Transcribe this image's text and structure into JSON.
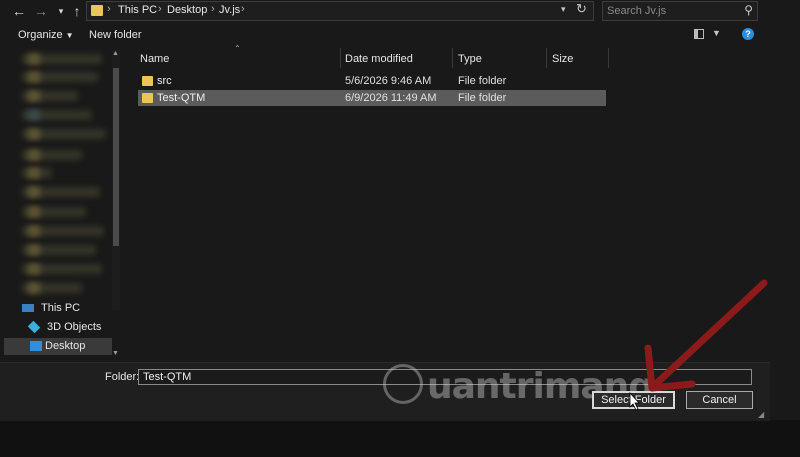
{
  "address": {
    "crumbs": [
      "This PC",
      "Desktop",
      "Jv.js"
    ],
    "search_placeholder": "Search Jv.js"
  },
  "toolbar": {
    "organize_label": "Organize",
    "new_folder_label": "New folder"
  },
  "sidebar": {
    "this_pc": "This PC",
    "objects": "3D Objects",
    "desktop": "Desktop"
  },
  "columns": {
    "name": "Name",
    "date": "Date modified",
    "type": "Type",
    "size": "Size"
  },
  "files": [
    {
      "name": "src",
      "date": "5/6/2026 9:46 AM",
      "type": "File folder",
      "selected": false
    },
    {
      "name": "Test-QTM",
      "date": "6/9/2026 11:49 AM",
      "type": "File folder",
      "selected": true
    }
  ],
  "footer": {
    "folder_label": "Folder:",
    "folder_value": "Test-QTM",
    "select_button": "Select Folder",
    "cancel_button": "Cancel"
  },
  "watermark": {
    "text": "uantrimang"
  },
  "colors": {
    "folder": "#e8c65a",
    "arrow": "#8b1a1a",
    "selection": "#5b5b5b"
  }
}
